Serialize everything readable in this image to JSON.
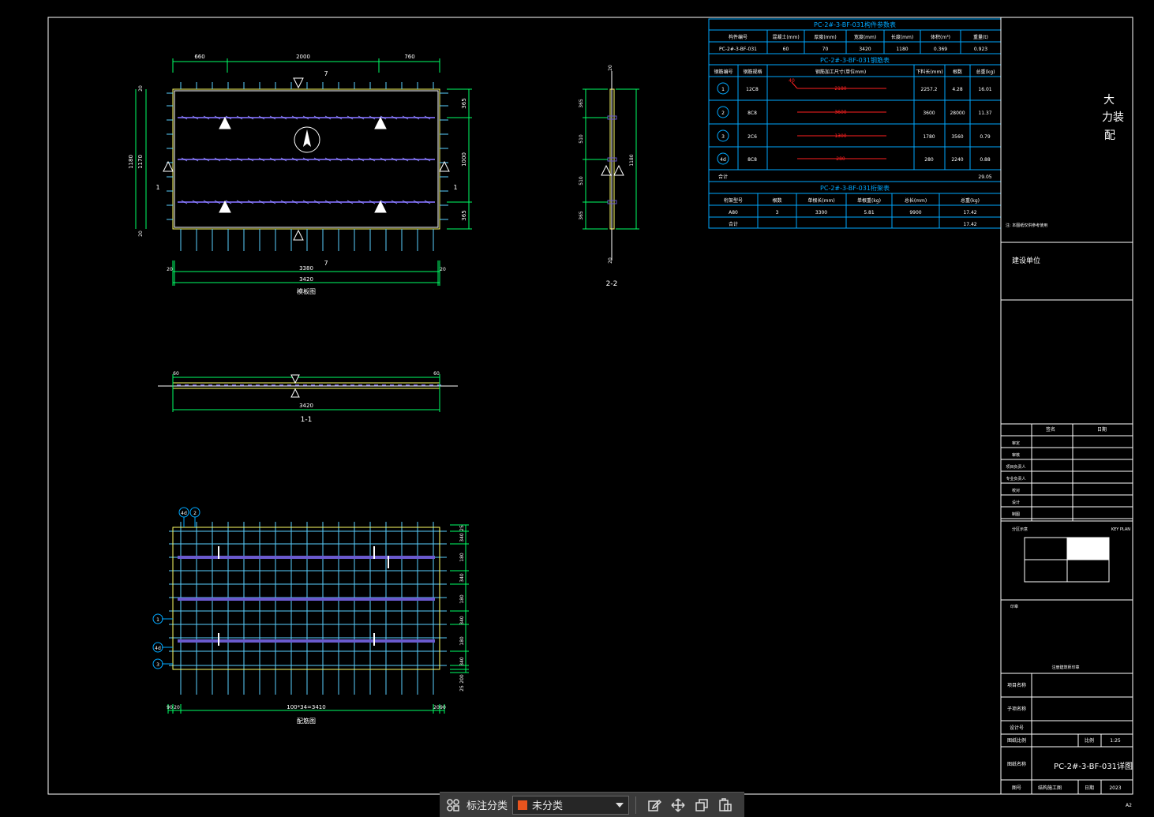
{
  "colors": {
    "background": "#000000",
    "frame": "#ffffff",
    "dimension": "#00ff66",
    "table": "#00a8ff",
    "rebar_blue": "#5ad0ff",
    "rebar_purple": "#6a5acd",
    "rebar_red": "#ff2020",
    "panel_outline": "#ffff66",
    "toolbar_bg": "#3a3a3a",
    "category_swatch": "#e8541e"
  },
  "plan_view": {
    "top_dims": [
      "660",
      "2000",
      "760"
    ],
    "bottom_dims": [
      "20",
      "3380",
      "20",
      "3420"
    ],
    "left_dims": [
      "20",
      "1170",
      "1180",
      "20"
    ],
    "right_dims": [
      "365",
      "1000",
      "365"
    ],
    "section_marks": [
      "7",
      "7",
      "1",
      "1"
    ],
    "title": "模板图"
  },
  "section_1": {
    "dims": [
      "60",
      "60",
      "3420"
    ],
    "title": "1-1"
  },
  "section_2": {
    "dims": [
      "365",
      "510",
      "510",
      "365",
      "1180",
      "20",
      "20"
    ],
    "title": "2-2"
  },
  "rebar_view": {
    "markers": [
      "4d",
      "2",
      "1",
      "4d",
      "3"
    ],
    "right_dims": [
      "25",
      "340",
      "180",
      "340",
      "180",
      "340",
      "180",
      "340",
      "200",
      "25"
    ],
    "bottom_dims": [
      "90",
      "20",
      "100*34=3410",
      "20",
      "90"
    ],
    "title": "配筋图"
  },
  "table1": {
    "title": "PC-2#-3-BF-031构件参数表",
    "headers": [
      "构件编号",
      "混凝土(mm)",
      "厚度(mm)",
      "宽度(mm)",
      "长度(mm)",
      "体积(m³)",
      "重量(t)"
    ],
    "row": [
      "PC-2#-3-BF-031",
      "60",
      "70",
      "3420",
      "1180",
      "0.369",
      "0.923"
    ]
  },
  "table2": {
    "title": "PC-2#-3-BF-031钢筋表",
    "headers": [
      "钢筋编号",
      "钢筋规格",
      "钢筋加工尺寸(单位mm)",
      "下料长(mm)",
      "根数",
      "总重(kg)"
    ],
    "rows": [
      {
        "id": "1",
        "spec": "12C8",
        "shape": "2180",
        "hook": "40",
        "len": "2257.2",
        "count": "4.28",
        "weight": "16.01"
      },
      {
        "id": "2",
        "spec": "8C8",
        "shape": "3600",
        "len": "3600",
        "count": "28000",
        "weight": "11.37"
      },
      {
        "id": "3",
        "spec": "2C6",
        "shape": "1300",
        "len": "1780",
        "count": "3560",
        "weight": "0.79"
      },
      {
        "id": "4d",
        "spec": "8C8",
        "shape": "280",
        "len": "280",
        "count": "2240",
        "weight": "0.88"
      }
    ],
    "total_label": "合计",
    "total": "29.05"
  },
  "table3": {
    "title": "PC-2#-3-BF-031桁架表",
    "headers": [
      "桁架型号",
      "根数",
      "单根长(mm)",
      "单根重(kg)",
      "总长(mm)",
      "总重(kg)"
    ],
    "row": [
      "A80",
      "3",
      "3300",
      "5.81",
      "9900",
      "17.42"
    ],
    "total_label": "合计",
    "total": "17.42"
  },
  "title_block": {
    "big_chars": [
      "大",
      "力装",
      "配"
    ],
    "notes": "注: 本图纸仅供参考使用",
    "client_label": "建设单位",
    "sign_headers": [
      "签名",
      "日期"
    ],
    "sign_rows": [
      "审定",
      "审核",
      "项目负责人",
      "专业负责人",
      "校对",
      "设计",
      "制图"
    ],
    "key_plan_label": "KEY PLAN",
    "key_plan_left": "分区示意",
    "seal_label": "印章",
    "seal_text": "注册建筑师印章",
    "project_name_label": "项目名称",
    "sub_project_label": "子项名称",
    "design_no_label": "设计号",
    "drawing_scale_label": "图纸比例",
    "scale_label": "比例",
    "scale": "1:25",
    "drawing_name_label": "图纸名称",
    "drawing_name": "PC-2#-3-BF-031详图",
    "sheet_no_label": "图号",
    "sheet_no": "结构施工图",
    "date_label": "日期",
    "date": "2023",
    "corner": "A2"
  },
  "toolbar": {
    "label": "标注分类",
    "selected": "未分类",
    "icons": [
      "grid-icon",
      "edit-icon",
      "move-icon",
      "copy-icon",
      "paste-icon"
    ]
  }
}
